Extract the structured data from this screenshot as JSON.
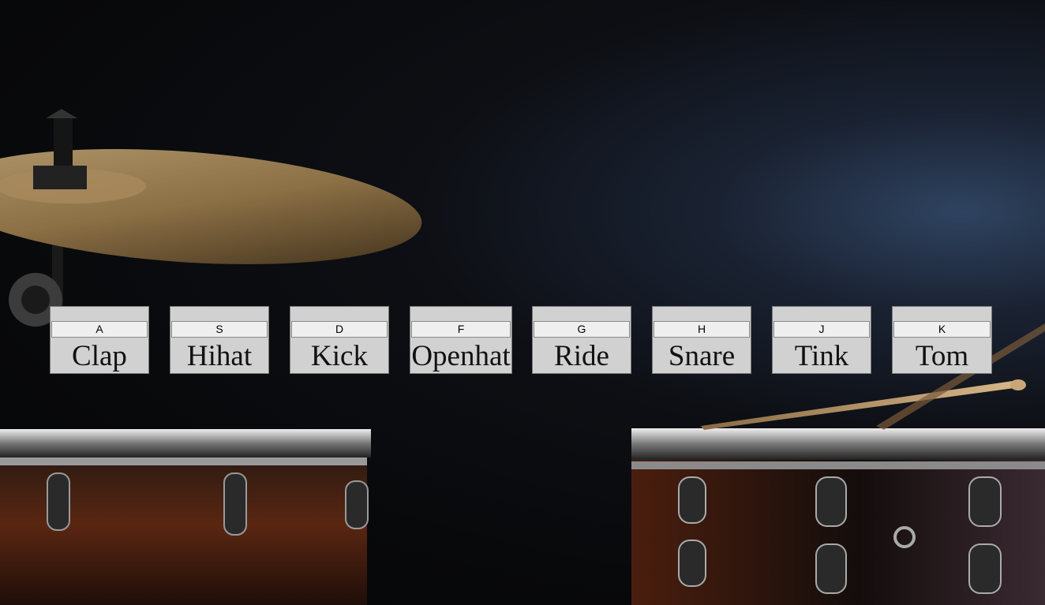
{
  "pads": [
    {
      "key": "A",
      "sound": "Clap"
    },
    {
      "key": "S",
      "sound": "Hihat"
    },
    {
      "key": "D",
      "sound": "Kick"
    },
    {
      "key": "F",
      "sound": "Openhat"
    },
    {
      "key": "G",
      "sound": "Ride"
    },
    {
      "key": "H",
      "sound": "Snare"
    },
    {
      "key": "J",
      "sound": "Tink"
    },
    {
      "key": "K",
      "sound": "Tom"
    }
  ],
  "colors": {
    "background": "#08090b",
    "pad": "#d1d1d1",
    "key": "#efefef"
  }
}
